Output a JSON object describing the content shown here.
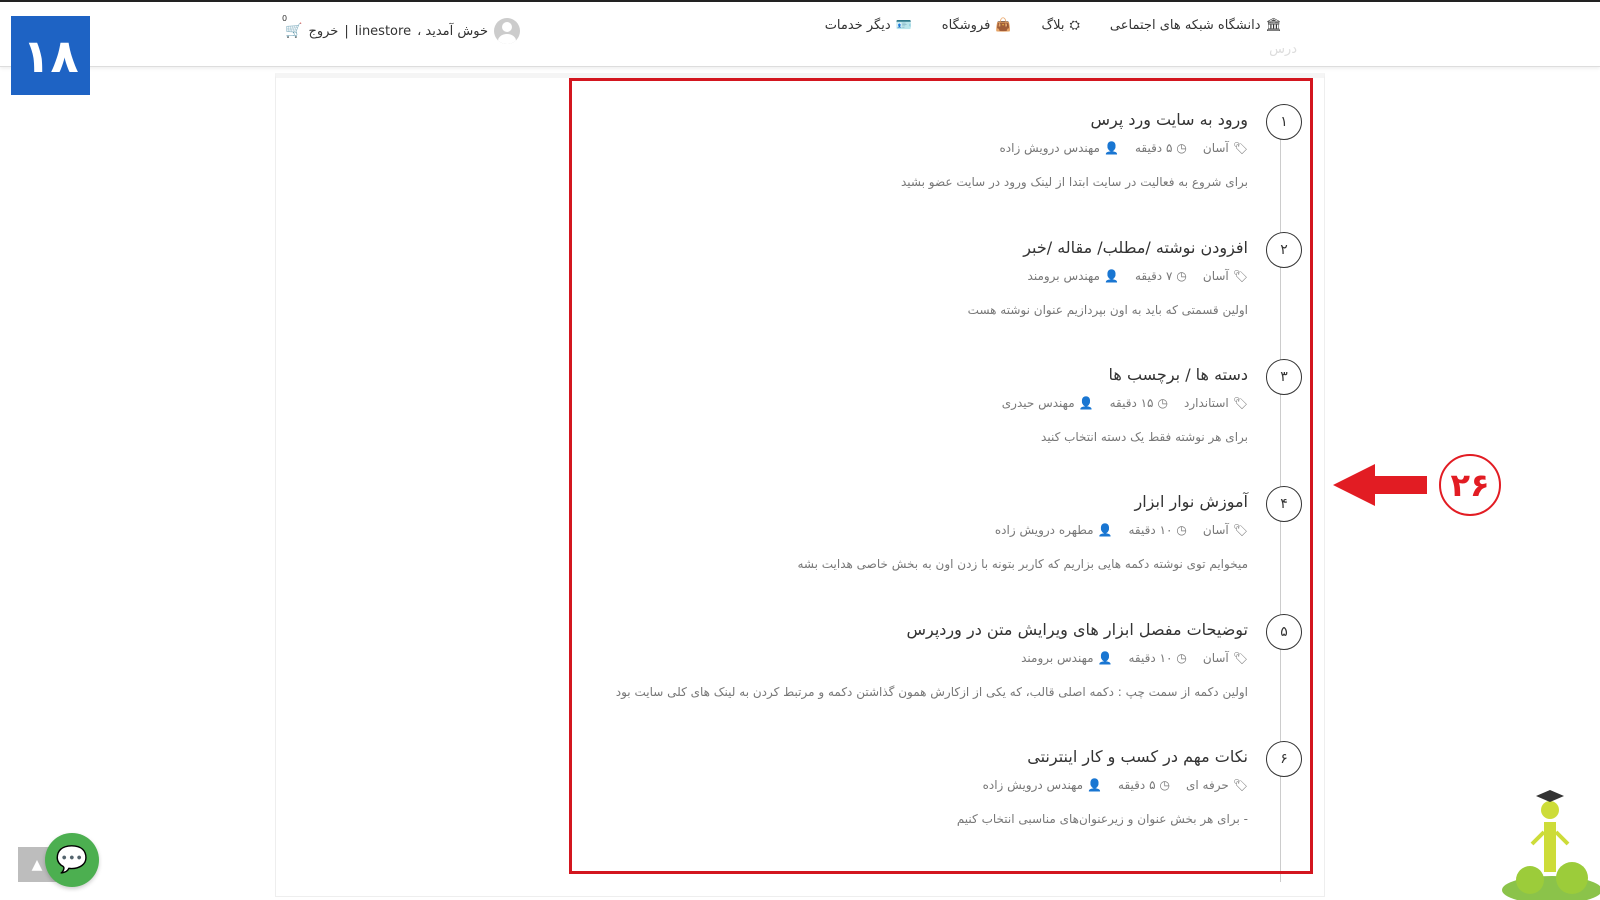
{
  "nav": {
    "items": [
      {
        "label": "دانشگاه شبکه های اجتماعی",
        "icon": "university-icon",
        "glyph": "🏛"
      },
      {
        "label": "بلاگ",
        "icon": "sitemap-icon",
        "glyph": "⛭"
      },
      {
        "label": "فروشگاه",
        "icon": "shopping-bag-icon",
        "glyph": "👜"
      },
      {
        "label": "دیگر خدمات",
        "icon": "id-card-icon",
        "glyph": "🪪"
      }
    ],
    "ghost_text": "درس"
  },
  "user": {
    "welcome": "خوش آمدید ،",
    "username": "linestore",
    "separator": "|",
    "logout": "خروج",
    "cart_count": "0"
  },
  "badge": {
    "text": "۱۸"
  },
  "annotation": {
    "number": "۲۶",
    "color": "#e21c23"
  },
  "colors": {
    "accent_red": "#d3161f",
    "badge_blue": "#1e63c4",
    "chat_green": "#4caf50"
  },
  "lessons": [
    {
      "num": "۱",
      "title": "ورود به سایت ورد پرس",
      "level": "آسان",
      "duration": "۵ دقیقه",
      "author": "مهندس درویش زاده",
      "desc": "برای شروع به فعالیت در سایت ابتدا از لینک ورود در سایت عضو بشید"
    },
    {
      "num": "۲",
      "title": "افزودن نوشته /مطلب/ مقاله /خبر",
      "level": "آسان",
      "duration": "۷ دقیقه",
      "author": "مهندس برومند",
      "desc": "اولین قسمتی که باید به اون بپردازیم عنوان نوشته هست"
    },
    {
      "num": "۳",
      "title": "دسته ها / برچسب ها",
      "level": "استاندارد",
      "duration": "۱۵ دقیقه",
      "author": "مهندس حیدری",
      "desc": "برای هر نوشته فقط یک دسته انتخاب کنید"
    },
    {
      "num": "۴",
      "title": "آموزش نوار ابزار",
      "level": "آسان",
      "duration": "۱۰ دقیقه",
      "author": "مطهره درویش زاده",
      "desc": "میخوایم توی نوشته دکمه هایی بزاریم که کاربر بتونه با زدن اون به بخش خاصی هدایت بشه"
    },
    {
      "num": "۵",
      "title": "توضیحات مفصل ابزار های ویرایش متن در وردپرس",
      "level": "آسان",
      "duration": "۱۰ دقیقه",
      "author": "مهندس برومند",
      "desc": "اولین دکمه از سمت چپ : دکمه اصلی قالب، که یکی از ازکارش همون گذاشتن دکمه و مرتبط کردن به لینک های کلی سایت بود"
    },
    {
      "num": "۶",
      "title": "نکات مهم در کسب و کار اینترنتی",
      "level": "حرفه ای",
      "duration": "۵ دقیقه",
      "author": "مهندس درویش زاده",
      "desc": "- برای هر بخش عنوان و زیرعنوان‌های مناسبی انتخاب کنیم"
    }
  ]
}
